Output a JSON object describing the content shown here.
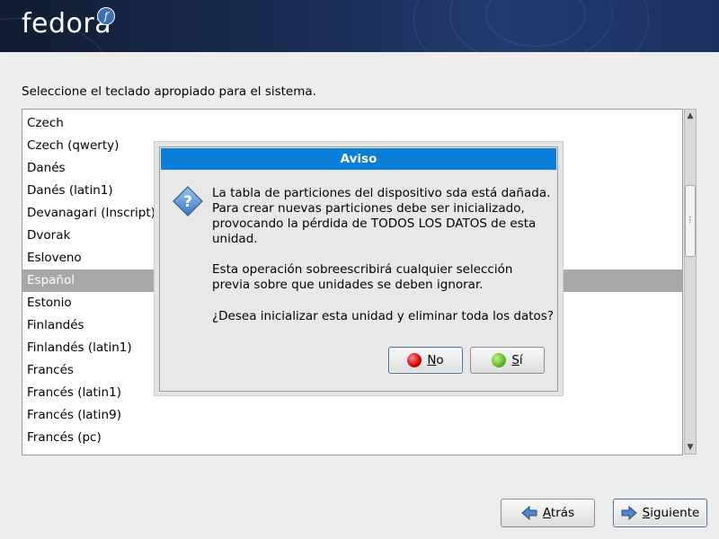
{
  "header": {
    "logo_text": "fedora",
    "logo_mark": "f"
  },
  "prompt": "Seleccione el teclado apropiado para el sistema.",
  "keyboards": {
    "items": [
      "Czech",
      "Czech (qwerty)",
      "Danés",
      "Danés (latin1)",
      "Devanagari (Inscript)",
      "Dvorak",
      "Esloveno",
      "Español",
      "Estonio",
      "Finlandés",
      "Finlandés (latin1)",
      "Francés",
      "Francés (latin1)",
      "Francés (latin9)",
      "Francés (pc)"
    ],
    "selected": "Español"
  },
  "dialog": {
    "title": "Aviso",
    "icon": "question-icon",
    "message_1": [
      "La tabla de particiones del dispositivo sda está dañada.",
      "Para crear nuevas particiones debe ser inicializado,",
      "provocando la pérdida de TODOS LOS DATOS de esta",
      "unidad."
    ],
    "message_2": [
      "Esta operación sobreescribirá cualquier selección",
      "previa sobre que unidades se deben ignorar."
    ],
    "question": "¿Desea inicializar esta unidad y eliminar toda los datos?",
    "no_label": {
      "mnemonic": "N",
      "rest": "o"
    },
    "yes_label": {
      "mnemonic": "S",
      "rest": "í"
    }
  },
  "nav": {
    "back": {
      "pre": "",
      "mnemonic": "A",
      "rest": "trás"
    },
    "next": {
      "pre": "",
      "mnemonic": "S",
      "rest": "iguiente"
    }
  },
  "colors": {
    "dialog_title_bg": "#0a7ed8",
    "selected_row_bg": "#a8a8a8",
    "banner": "#1a2e55"
  }
}
